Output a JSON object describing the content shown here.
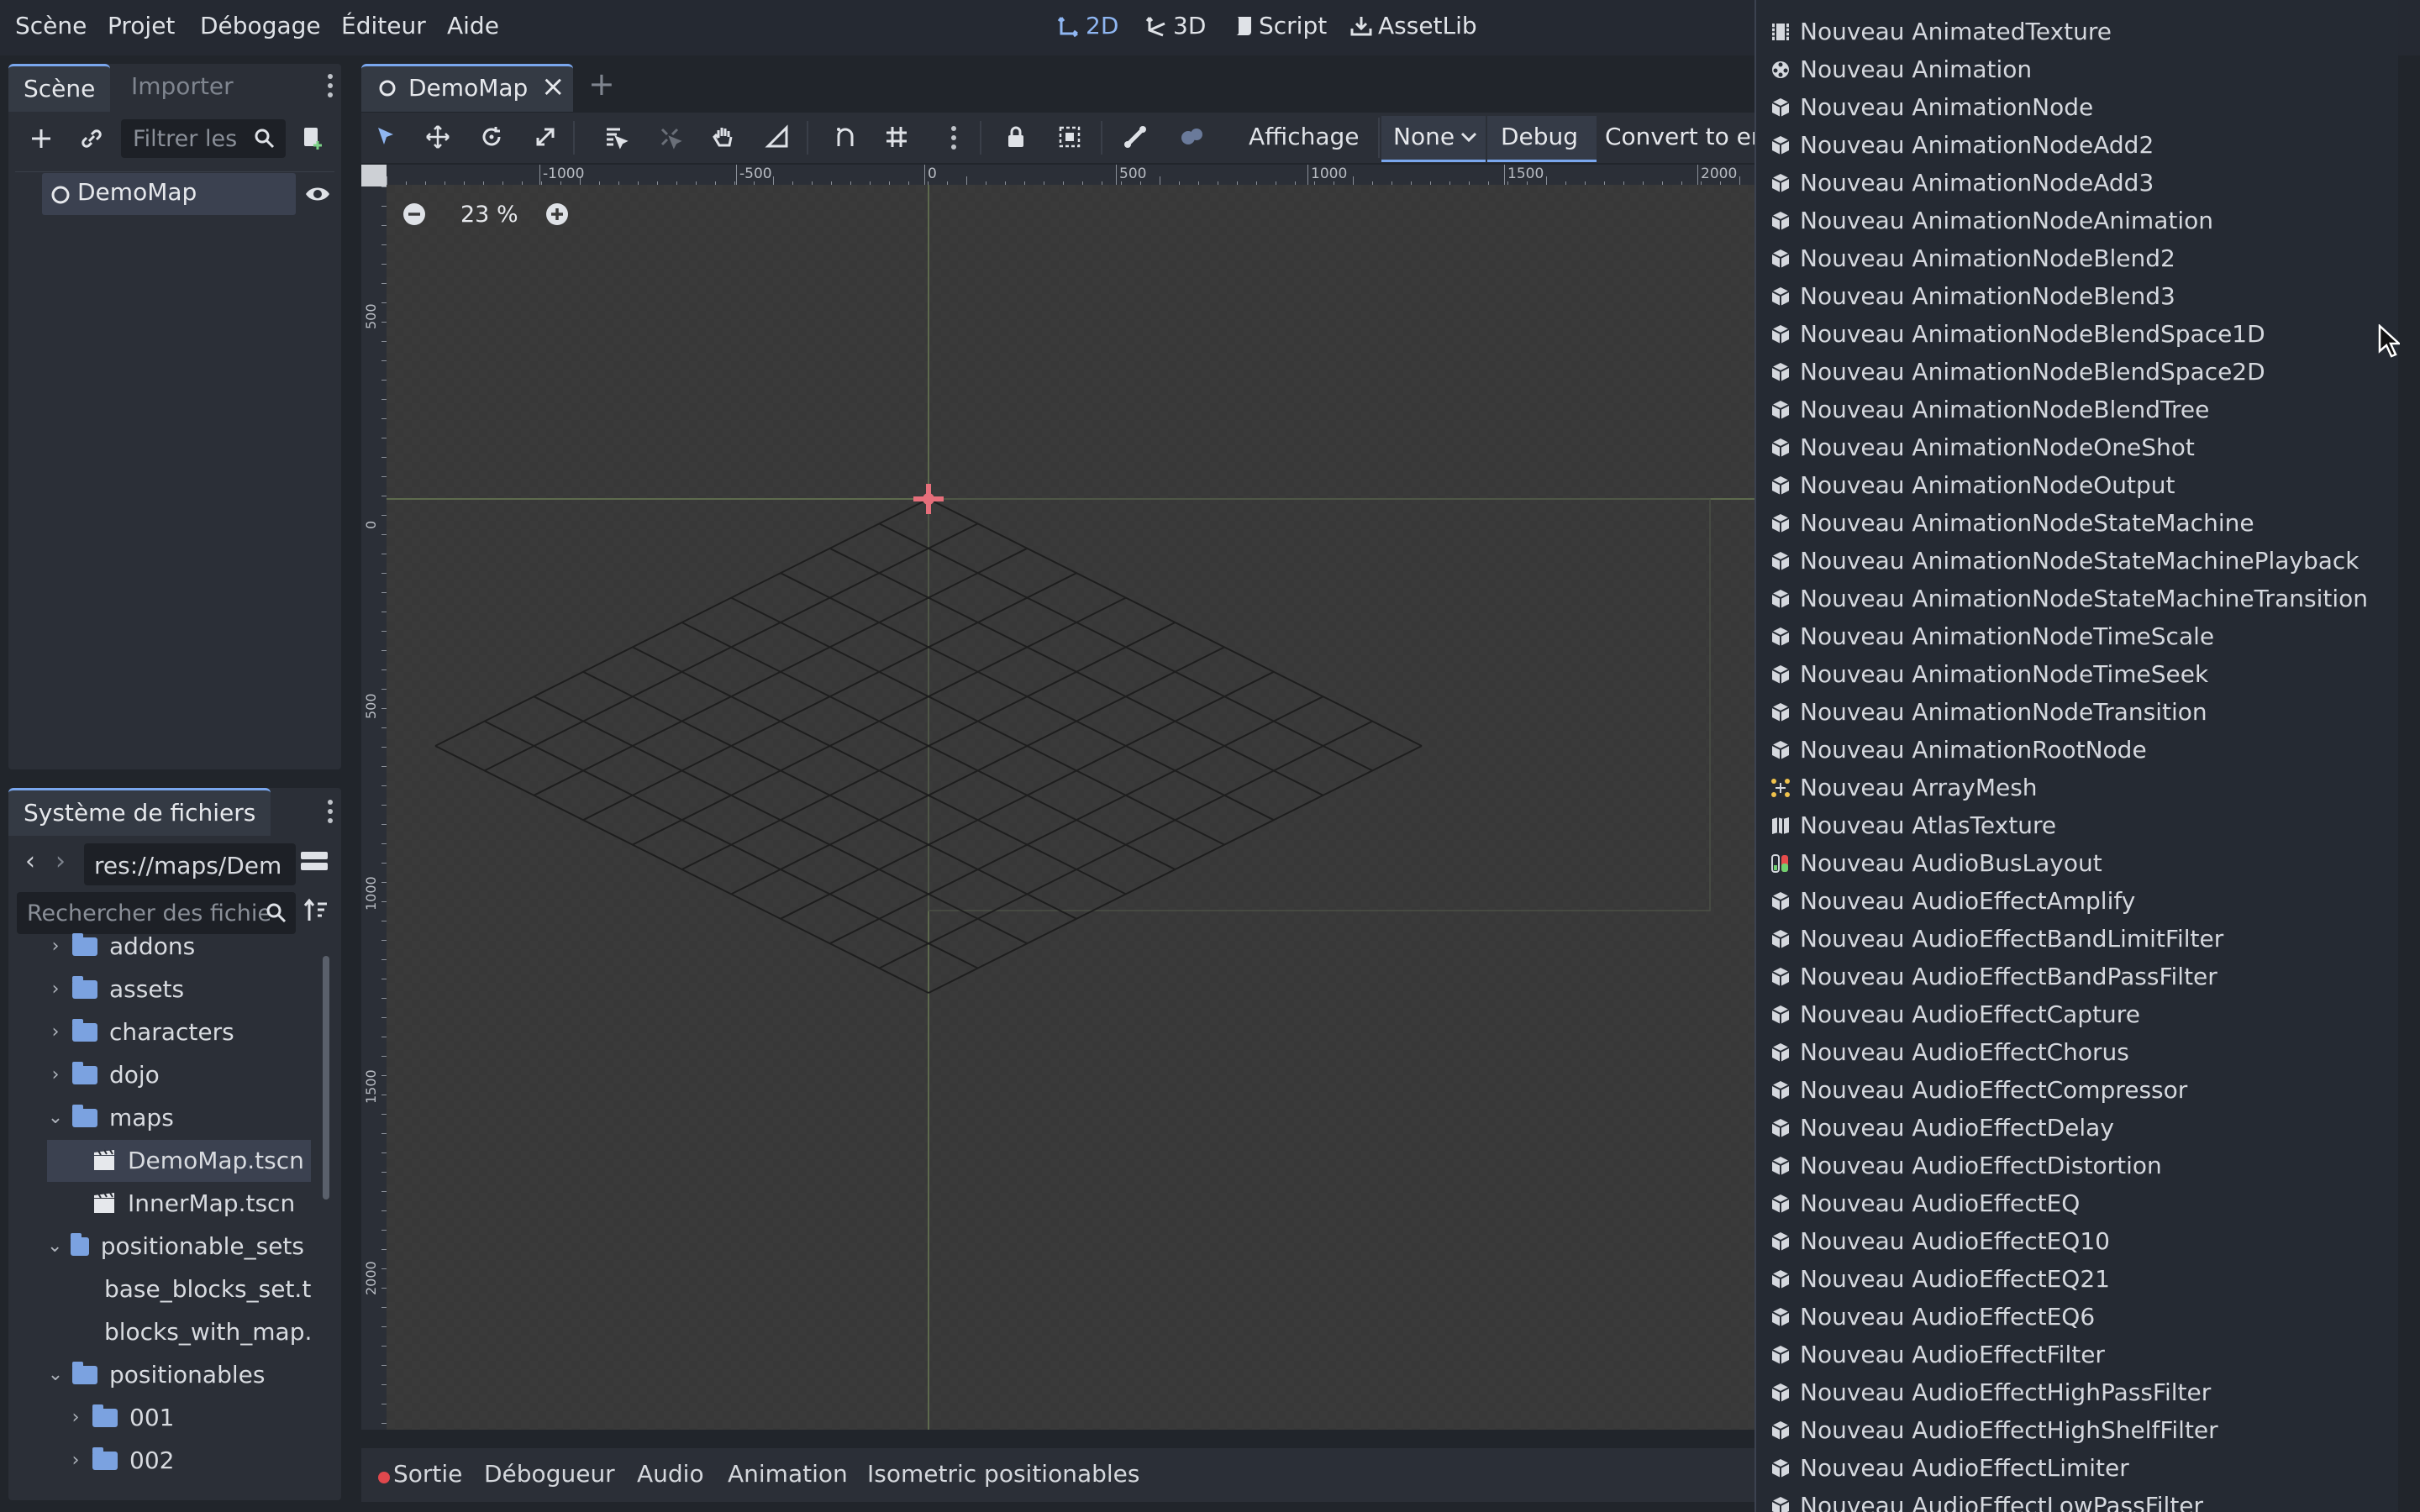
{
  "menubar": {
    "items": [
      "Scène",
      "Projet",
      "Débogage",
      "Éditeur",
      "Aide"
    ],
    "workspaces": [
      {
        "label": "2D",
        "icon": "2d-icon",
        "active": true
      },
      {
        "label": "3D",
        "icon": "3d-icon",
        "active": false
      },
      {
        "label": "Script",
        "icon": "script-icon",
        "active": false
      },
      {
        "label": "AssetLib",
        "icon": "assetlib-icon",
        "active": false
      }
    ]
  },
  "scene_panel": {
    "tabs": [
      "Scène",
      "Importer"
    ],
    "filter_placeholder": "Filtrer les",
    "root_node": "DemoMap"
  },
  "filesystem_panel": {
    "title": "Système de fichiers",
    "path": "res://maps/Dem",
    "search_placeholder": "Rechercher des fichie",
    "tree": [
      {
        "label": "addons",
        "type": "folder",
        "depth": 1,
        "expanded": false
      },
      {
        "label": "assets",
        "type": "folder",
        "depth": 1,
        "expanded": false
      },
      {
        "label": "characters",
        "type": "folder",
        "depth": 1,
        "expanded": false
      },
      {
        "label": "dojo",
        "type": "folder",
        "depth": 1,
        "expanded": false
      },
      {
        "label": "maps",
        "type": "folder",
        "depth": 1,
        "expanded": true
      },
      {
        "label": "DemoMap.tscn",
        "type": "scene",
        "depth": 2,
        "selected": true
      },
      {
        "label": "InnerMap.tscn",
        "type": "scene",
        "depth": 2
      },
      {
        "label": "positionable_sets",
        "type": "folder",
        "depth": 1,
        "expanded": true
      },
      {
        "label": "base_blocks_set.t",
        "type": "file",
        "depth": 2
      },
      {
        "label": "blocks_with_map.",
        "type": "file",
        "depth": 2
      },
      {
        "label": "positionables",
        "type": "folder",
        "depth": 1,
        "expanded": true
      },
      {
        "label": "001",
        "type": "folder",
        "depth": 2,
        "expanded": false
      },
      {
        "label": "002",
        "type": "folder",
        "depth": 2,
        "expanded": false
      }
    ]
  },
  "editor": {
    "tab_title": "DemoMap",
    "toolbar": {
      "view_label": "Affichage",
      "none_label": "None",
      "debug_label": "Debug",
      "convert_label": "Convert to en"
    },
    "zoom_label": "23 %",
    "ruler_h": [
      "-1000",
      "-500",
      "0",
      "500",
      "1000",
      "1500",
      "2000"
    ],
    "ruler_v": [
      "500",
      "0",
      "500",
      "1000",
      "1500",
      "2000"
    ]
  },
  "bottom_tabs": [
    "Sortie",
    "Débogueur",
    "Audio",
    "Animation",
    "Isometric positionables"
  ],
  "popup_menu": {
    "items": [
      {
        "label": "Nouveau AnimatedTexture",
        "icon": "film-icon"
      },
      {
        "label": "Nouveau Animation",
        "icon": "animation-icon"
      },
      {
        "label": "Nouveau AnimationNode",
        "icon": "resource-icon"
      },
      {
        "label": "Nouveau AnimationNodeAdd2",
        "icon": "resource-icon"
      },
      {
        "label": "Nouveau AnimationNodeAdd3",
        "icon": "resource-icon"
      },
      {
        "label": "Nouveau AnimationNodeAnimation",
        "icon": "resource-icon"
      },
      {
        "label": "Nouveau AnimationNodeBlend2",
        "icon": "resource-icon"
      },
      {
        "label": "Nouveau AnimationNodeBlend3",
        "icon": "resource-icon"
      },
      {
        "label": "Nouveau AnimationNodeBlendSpace1D",
        "icon": "resource-icon"
      },
      {
        "label": "Nouveau AnimationNodeBlendSpace2D",
        "icon": "resource-icon"
      },
      {
        "label": "Nouveau AnimationNodeBlendTree",
        "icon": "resource-icon"
      },
      {
        "label": "Nouveau AnimationNodeOneShot",
        "icon": "resource-icon"
      },
      {
        "label": "Nouveau AnimationNodeOutput",
        "icon": "resource-icon"
      },
      {
        "label": "Nouveau AnimationNodeStateMachine",
        "icon": "resource-icon"
      },
      {
        "label": "Nouveau AnimationNodeStateMachinePlayback",
        "icon": "resource-icon"
      },
      {
        "label": "Nouveau AnimationNodeStateMachineTransition",
        "icon": "resource-icon"
      },
      {
        "label": "Nouveau AnimationNodeTimeScale",
        "icon": "resource-icon"
      },
      {
        "label": "Nouveau AnimationNodeTimeSeek",
        "icon": "resource-icon"
      },
      {
        "label": "Nouveau AnimationNodeTransition",
        "icon": "resource-icon"
      },
      {
        "label": "Nouveau AnimationRootNode",
        "icon": "resource-icon"
      },
      {
        "label": "Nouveau ArrayMesh",
        "icon": "mesh-icon"
      },
      {
        "label": "Nouveau AtlasTexture",
        "icon": "atlas-icon"
      },
      {
        "label": "Nouveau AudioBusLayout",
        "icon": "audio-bus-icon"
      },
      {
        "label": "Nouveau AudioEffectAmplify",
        "icon": "resource-icon"
      },
      {
        "label": "Nouveau AudioEffectBandLimitFilter",
        "icon": "resource-icon"
      },
      {
        "label": "Nouveau AudioEffectBandPassFilter",
        "icon": "resource-icon"
      },
      {
        "label": "Nouveau AudioEffectCapture",
        "icon": "resource-icon"
      },
      {
        "label": "Nouveau AudioEffectChorus",
        "icon": "resource-icon"
      },
      {
        "label": "Nouveau AudioEffectCompressor",
        "icon": "resource-icon"
      },
      {
        "label": "Nouveau AudioEffectDelay",
        "icon": "resource-icon"
      },
      {
        "label": "Nouveau AudioEffectDistortion",
        "icon": "resource-icon"
      },
      {
        "label": "Nouveau AudioEffectEQ",
        "icon": "resource-icon"
      },
      {
        "label": "Nouveau AudioEffectEQ10",
        "icon": "resource-icon"
      },
      {
        "label": "Nouveau AudioEffectEQ21",
        "icon": "resource-icon"
      },
      {
        "label": "Nouveau AudioEffectEQ6",
        "icon": "resource-icon"
      },
      {
        "label": "Nouveau AudioEffectFilter",
        "icon": "resource-icon"
      },
      {
        "label": "Nouveau AudioEffectHighPassFilter",
        "icon": "resource-icon"
      },
      {
        "label": "Nouveau AudioEffectHighShelfFilter",
        "icon": "resource-icon"
      },
      {
        "label": "Nouveau AudioEffectLimiter",
        "icon": "resource-icon"
      },
      {
        "label": "Nouveau AudioEffectLowPassFilter",
        "icon": "resource-icon"
      }
    ]
  },
  "colors": {
    "accent": "#7aa7ee",
    "background": "#21252b",
    "panel": "#2b2f37",
    "viewport": "#3a3a3a",
    "folder": "#7ba2e0",
    "record_dot": "#e0484d"
  }
}
